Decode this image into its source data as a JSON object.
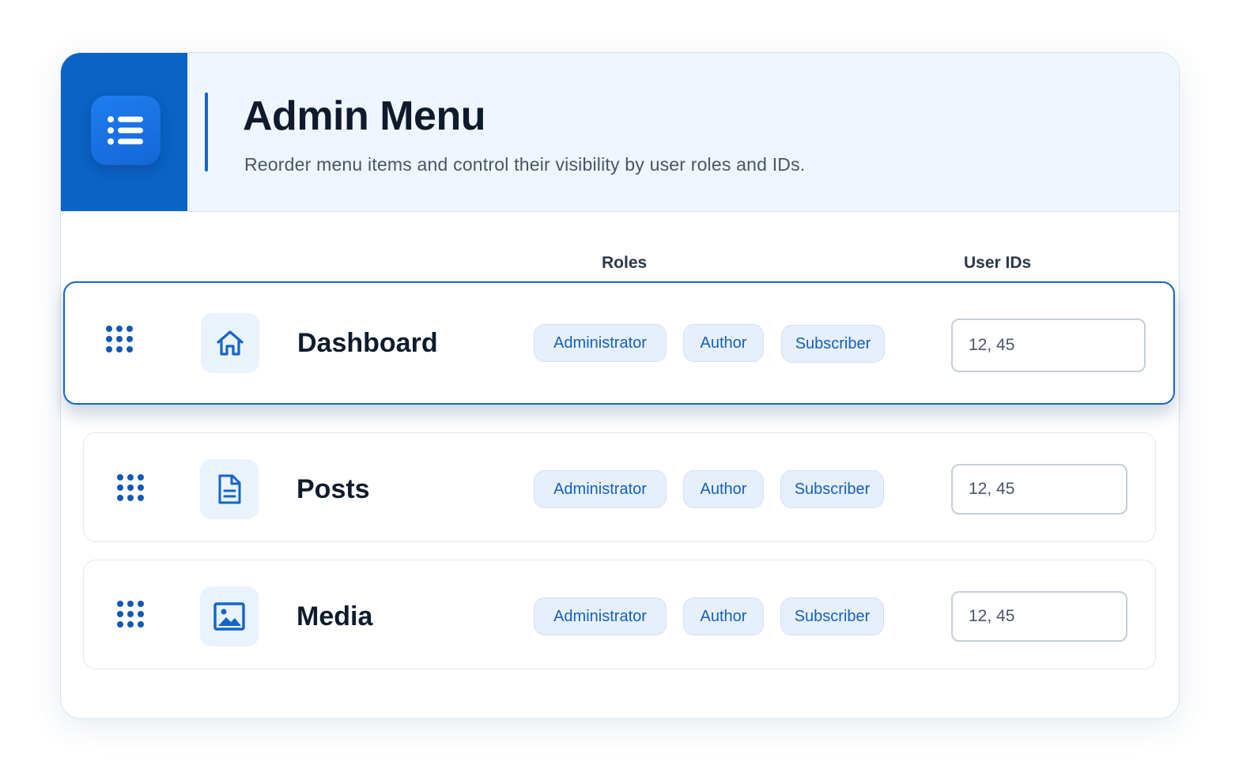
{
  "header": {
    "title": "Admin Menu",
    "subtitle": "Reorder menu items and control their visibility by user roles and IDs.",
    "icon": "list-icon"
  },
  "columns": {
    "roles": "Roles",
    "user_ids": "User IDs"
  },
  "items": [
    {
      "label": "Dashboard",
      "icon": "home-icon",
      "roles": [
        "Administrator",
        "Author",
        "Subscriber"
      ],
      "user_ids": "12, 45",
      "dragging": true
    },
    {
      "label": "Posts",
      "icon": "document-icon",
      "roles": [
        "Administrator",
        "Author",
        "Subscriber"
      ],
      "user_ids": "12, 45",
      "dragging": false
    },
    {
      "label": "Media",
      "icon": "image-icon",
      "roles": [
        "Administrator",
        "Author",
        "Subscriber"
      ],
      "user_ids": "12, 45",
      "dragging": false
    }
  ],
  "colors": {
    "accent": "#0b63c4",
    "chip_text": "#1560bd",
    "chip_bg": "#e6f0fb",
    "header_bg": "#f0f6fd"
  }
}
